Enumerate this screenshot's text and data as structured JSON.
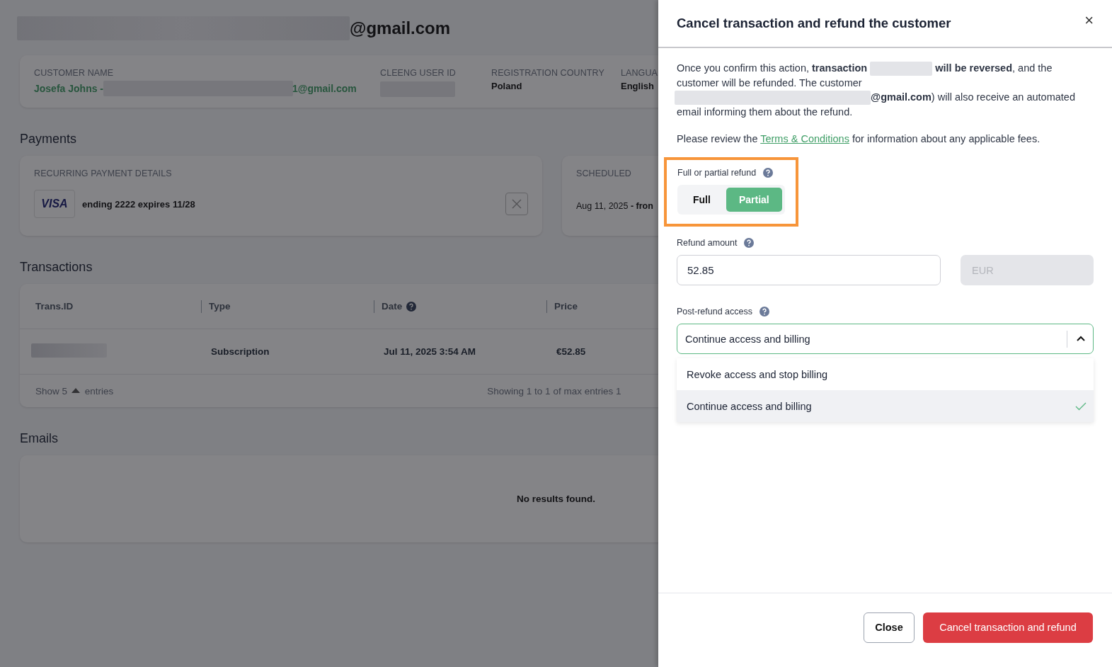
{
  "page": {
    "title_suffix": "@gmail.com",
    "customer": [
      {
        "label": "CUSTOMER NAME",
        "kind": "name",
        "value": "Josefa Johns - ",
        "email_tail": "1@gmail.com"
      },
      {
        "label": "CLEENG USER ID",
        "kind": "redacted"
      },
      {
        "label": "REGISTRATION COUNTRY",
        "kind": "text",
        "value": "Poland"
      },
      {
        "label": "LANGUA",
        "kind": "text",
        "value": "English"
      }
    ],
    "payments": {
      "heading": "Payments",
      "card_label": "RECURRING PAYMENT DETAILS",
      "card_brand": "VISA",
      "card_text": "ending 2222 expires 11/28",
      "scheduled_label": "SCHEDULED",
      "scheduled_date": "Aug 11, 2025",
      "scheduled_tail": " - fron"
    },
    "transactions": {
      "heading": "Transactions",
      "columns": [
        "Trans.ID",
        "Type",
        "Date",
        "Price"
      ],
      "rows": [
        {
          "type": "Subscription",
          "date": "Jul 11, 2025 3:54 AM",
          "price": "€52.85"
        }
      ],
      "show_label": "Show 5",
      "entries_label": "entries",
      "summary": "Showing 1 to 1 of max entries 1"
    },
    "emails": {
      "heading": "Emails",
      "empty": "No results found."
    }
  },
  "drawer": {
    "title": "Cancel transaction and refund the customer",
    "close": "×",
    "intro_1": "Once you confirm this action, **transaction**",
    "intro_2": "**will be reversed**, and the customer will be refunded. The customer",
    "intro_3": "**@gmail.com**) will also receive an automated email informing them about the refund.",
    "review_before": "Please review the",
    "review_link": "Terms & Conditions",
    "review_after": "for information about any applicable fees.",
    "refund_type": {
      "label": "Full or partial refund",
      "highlighted": true,
      "options": [
        {
          "label": "Full",
          "selected": false
        },
        {
          "label": "Partial",
          "selected": true
        }
      ]
    },
    "amount": {
      "label": "Refund amount",
      "value": "52.85",
      "currency": "EUR"
    },
    "access": {
      "label": "Post-refund access",
      "value": "Continue access and billing",
      "expanded": true,
      "options": [
        {
          "label": "Revoke access and stop billing",
          "selected": false
        },
        {
          "label": "Continue access and billing",
          "selected": true
        }
      ]
    },
    "buttons": [
      {
        "label": "Close",
        "kind": "secondary"
      },
      {
        "label": "Cancel transaction and refund",
        "kind": "danger"
      }
    ]
  }
}
